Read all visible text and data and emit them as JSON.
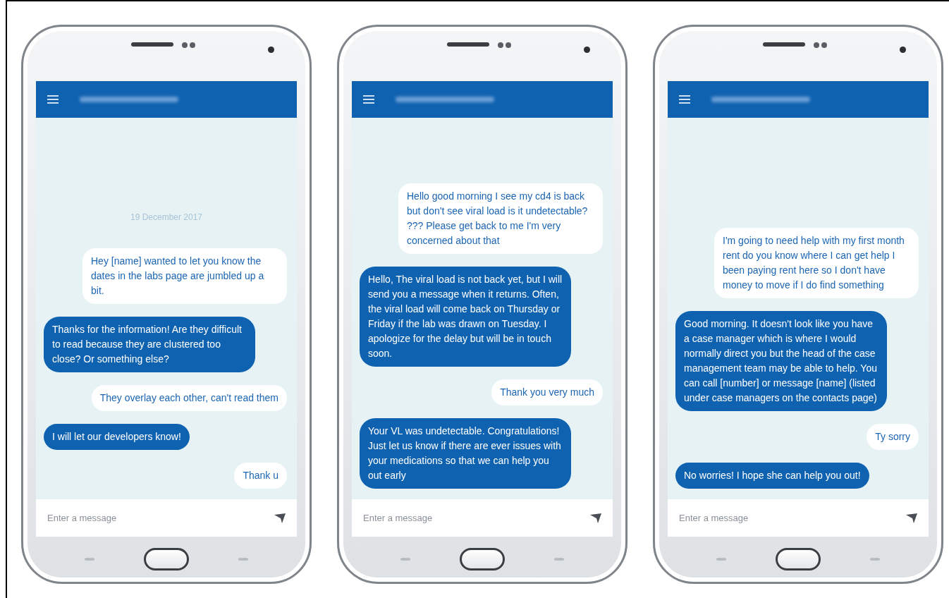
{
  "phones": [
    {
      "date": "19 December 2017",
      "messages": [
        {
          "kind": "sent",
          "text": "Hey [name] wanted to let you know the dates in the labs page are jumbled up a bit."
        },
        {
          "kind": "received",
          "text": "Thanks for the information! Are they difficult to read because they are clustered too close? Or something else?"
        },
        {
          "kind": "sent",
          "text": "They overlay each other, can't read them"
        },
        {
          "kind": "received",
          "text": "I will let our developers know!"
        },
        {
          "kind": "sent",
          "text": "Thank u"
        }
      ],
      "composer": {
        "placeholder": "Enter a message"
      }
    },
    {
      "messages": [
        {
          "kind": "sent",
          "text": "Hello good morning I see my cd4 is back but don't see viral load  is it undetectable? ??? Please get back to me I'm very concerned about that"
        },
        {
          "kind": "received",
          "text": "Hello, The viral load is not back yet, but I will send you a message when it returns. Often, the viral load will come back on Thursday or Friday if the lab was drawn on Tuesday. I apologize for the delay but will be in touch soon."
        },
        {
          "kind": "sent",
          "text": "Thank you very much"
        },
        {
          "kind": "received",
          "text": "Your VL was undetectable. Congratulations! Just let us know if there are ever issues with your medications so that we can help you out early"
        }
      ],
      "composer": {
        "placeholder": "Enter a message"
      }
    },
    {
      "messages": [
        {
          "kind": "sent",
          "text": "I'm going to need help with my first month rent do you know where I can get help I been paying rent here so I don't have money to move if I do find something"
        },
        {
          "kind": "received",
          "text": "Good morning. It doesn't look like you have a case manager which is where I would normally direct you but the head of the case management team may be able to help. You can call [number] or message [name] (listed under case managers on the contacts page)"
        },
        {
          "kind": "sent",
          "text": "Ty sorry"
        },
        {
          "kind": "received",
          "text": "No worries! I hope she can help you out!"
        }
      ],
      "composer": {
        "placeholder": "Enter a message"
      }
    }
  ]
}
